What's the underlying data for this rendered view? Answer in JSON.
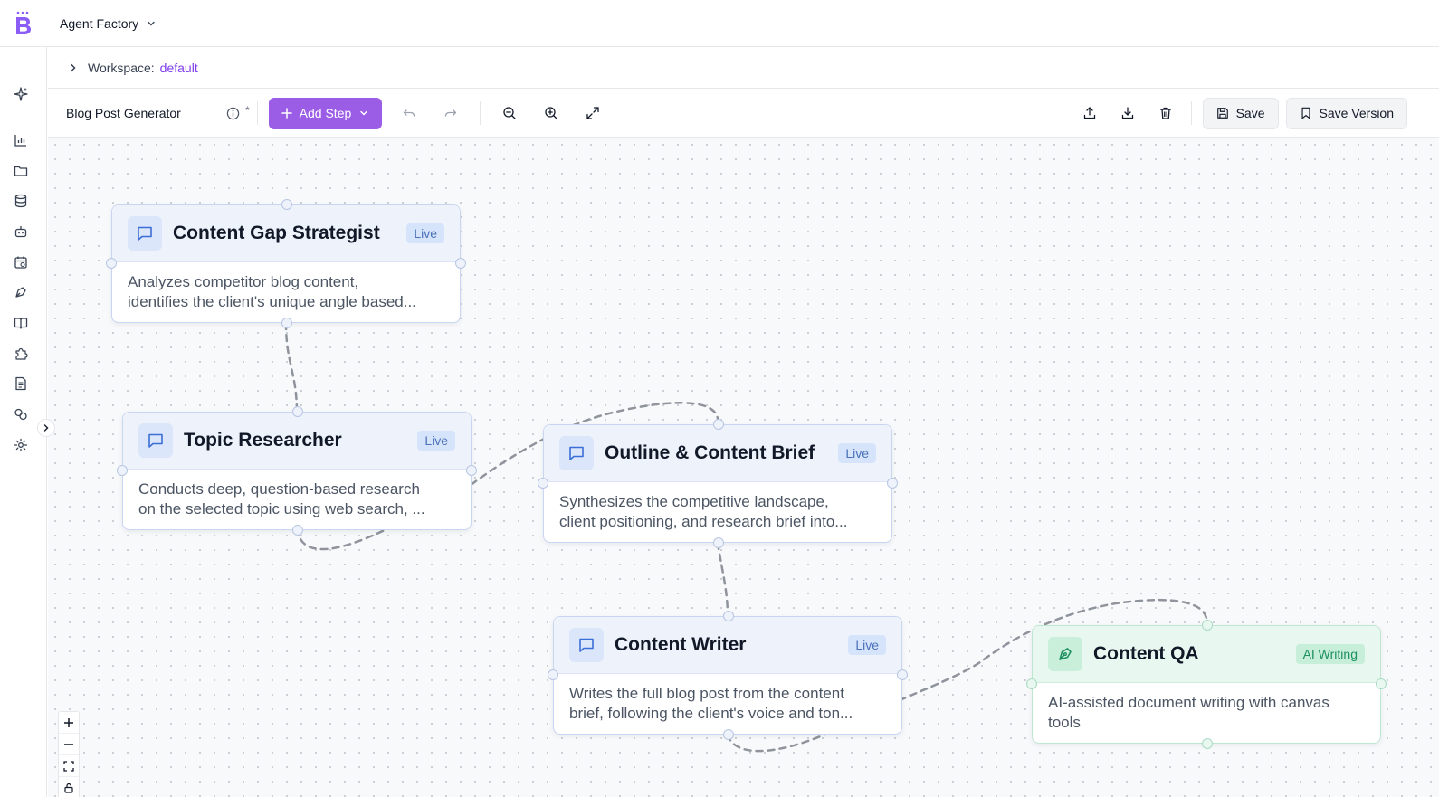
{
  "app": {
    "name": "Agent Factory"
  },
  "breadcrumb": {
    "label": "Workspace:",
    "value": "default"
  },
  "toolbar": {
    "flow_name": "Blog Post Generator",
    "unsaved_marker": "*",
    "add_step_label": "Add Step",
    "save_label": "Save",
    "save_version_label": "Save Version"
  },
  "nodes": [
    {
      "title": "Content Gap Strategist",
      "badge": "Live",
      "desc1": "Analyzes competitor blog content,",
      "desc2": "identifies the client's unique angle based..."
    },
    {
      "title": "Topic Researcher",
      "badge": "Live",
      "desc1": "Conducts deep, question-based research",
      "desc2": "on the selected topic using web search, ..."
    },
    {
      "title": "Outline & Content Brief",
      "badge": "Live",
      "desc1": "Synthesizes the competitive landscape,",
      "desc2": "client positioning, and research brief into..."
    },
    {
      "title": "Content Writer",
      "badge": "Live",
      "desc1": "Writes the full blog post from the content",
      "desc2": "brief, following the client's voice and ton..."
    },
    {
      "title": "Content QA",
      "badge": "AI Writing",
      "desc1": "AI-assisted document writing with canvas tools"
    }
  ],
  "colors": {
    "accent": "#9b5de5",
    "node_border": "#c9d6f2",
    "qa_accent": "#1f8f5f"
  },
  "icons": {
    "rail": [
      "sparkles-icon",
      "chart-icon",
      "folder-icon",
      "database-icon",
      "bot-icon",
      "calendar-icon",
      "pen-tool-icon",
      "book-icon",
      "puzzle-icon",
      "file-text-icon",
      "link-icon",
      "settings-icon"
    ]
  }
}
